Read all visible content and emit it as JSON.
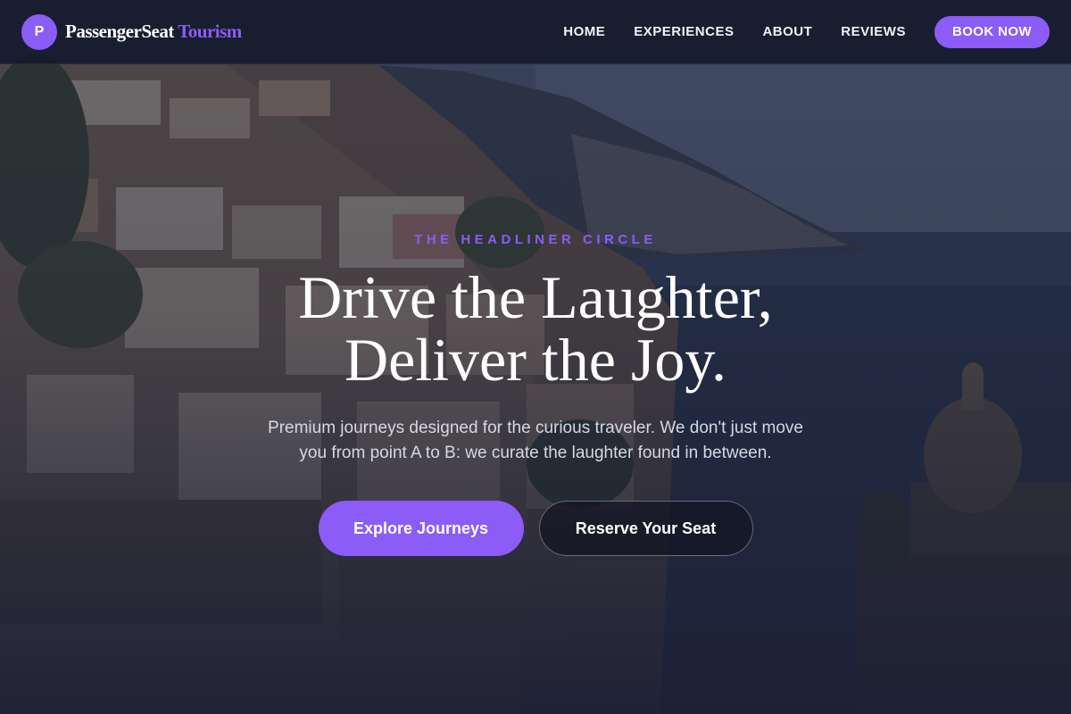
{
  "nav": {
    "logo_letter": "P",
    "brand_primary": "PassengerSeat",
    "brand_accent": "Tourism",
    "links": [
      "HOME",
      "EXPERIENCES",
      "ABOUT",
      "REVIEWS"
    ],
    "cta": "BOOK NOW"
  },
  "hero": {
    "eyebrow": "THE HEADLINER CIRCLE",
    "headline_line1": "Drive the Laughter,",
    "headline_line2": "Deliver the Joy.",
    "subtext_line1": "Premium journeys designed for the curious traveler. We don't just move",
    "subtext_line2": "you from point A to B: we curate the laughter found in between.",
    "primary_cta": "Explore Journeys",
    "secondary_cta": "Reserve Your Seat"
  },
  "colors": {
    "accent": "#8b5cf6",
    "nav_bg": "#161b2d",
    "page_bg": "#1b2033"
  },
  "background_image": "coastal-cliffside-village-photo"
}
